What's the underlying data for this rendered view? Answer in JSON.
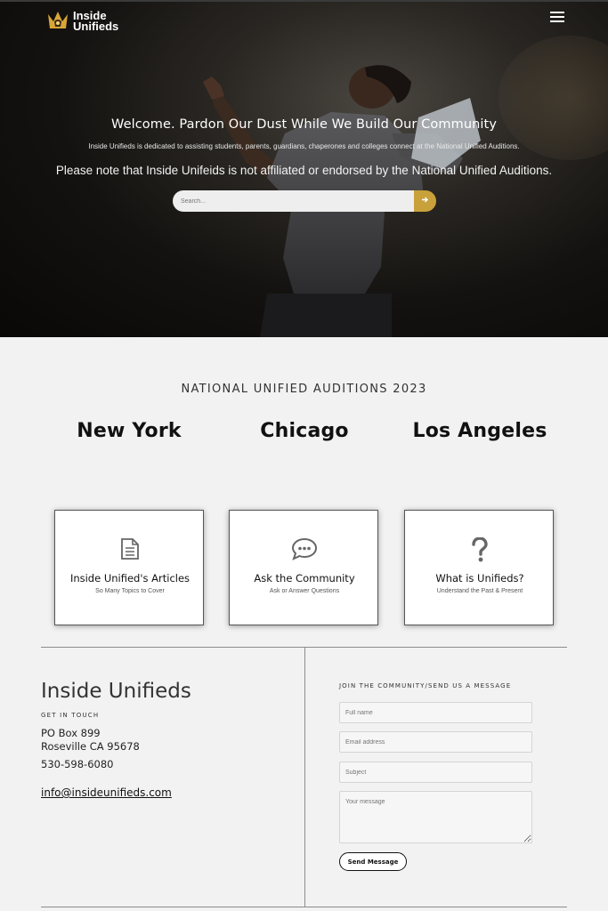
{
  "header": {
    "logo_line1": "Inside",
    "logo_line2": "Unifieds"
  },
  "hero": {
    "title": "Welcome. Pardon Our Dust While We Build Our Community",
    "subtitle": "Inside Unifieds is dedicated to assisting students, parents, guardians, chaperones and colleges connect at the National Unified Auditions.",
    "note": "Please note that Inside Unifeids is not affiliated or endorsed by the National Unified Auditions.",
    "search_placeholder": "Search...",
    "search_button_icon": "arrow-right-icon"
  },
  "auditions": {
    "title": "NATIONAL UNIFIED AUDITIONS 2023",
    "cities": [
      "New York",
      "Chicago",
      "Los Angeles"
    ]
  },
  "cards": [
    {
      "title": "Inside Unified's Articles",
      "subtitle": "So Many Topics to Cover",
      "icon": "document-icon"
    },
    {
      "title": "Ask the Community",
      "subtitle": "Ask or Answer Questions",
      "icon": "chat-bubble-icon"
    },
    {
      "title": "What is Unifieds?",
      "subtitle": "Understand the Past & Present",
      "icon": "question-mark-icon"
    }
  ],
  "contact": {
    "brand": "Inside Unifieds",
    "get_in_touch": "GET IN TOUCH",
    "address_line1": "PO Box 899",
    "address_line2": "Roseville CA 95678",
    "phone": "530-598-6080",
    "email": "info@insideunifieds.com"
  },
  "form": {
    "heading": "JOIN THE COMMUNITY/SEND US A MESSAGE",
    "name_placeholder": "Full name",
    "email_placeholder": "Email address",
    "subject_placeholder": "Subject",
    "message_placeholder": "Your message",
    "send_label": "Send Message"
  },
  "colors": {
    "accent_gold": "#c9a13b",
    "background": "#f2f2f3",
    "hero_dark": "#141210"
  }
}
